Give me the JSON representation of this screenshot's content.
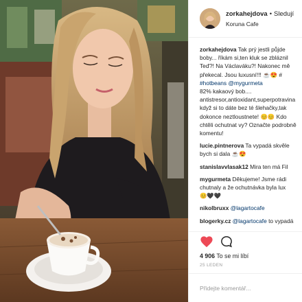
{
  "header": {
    "username": "zorkahejdova",
    "separator": "•",
    "follow_label": "Sledují",
    "location": "Koruna Cafe"
  },
  "caption": {
    "username": "zorkahejdova",
    "lines": [
      "Tak prý jestli půjde",
      "boby... říkám si,ten kluk se zbláznil",
      "Teď?! Na Václaváku?! Nakonec mě",
      "překecal. Jsou luxusní!!! "
    ],
    "hashtag": "#hotbeans",
    "mention": "@mygurmeta",
    "rest_lines": [
      "82% kakaový bob....",
      "antistresor,antioxidant,superpotravina",
      "když si to dáte bez té šlehačky,tak",
      "dokonce neztloustnete! 😊😊 Kdo",
      "chtěli ochutnat vy? Označte podrobně",
      "komentu!"
    ],
    "line4_tail": "☕😍 #",
    "line5_lead": ""
  },
  "comments": [
    {
      "username": "lucie.pintnerova",
      "lines": [
        "Ta vypadá skvěle",
        "bych si dala ☕😍"
      ]
    },
    {
      "username": "stanislavvlasak12",
      "lines": [
        "Mira ten má Fil"
      ]
    },
    {
      "username": "mygurmeta",
      "lines": [
        "Děkujeme! Jsme rádi",
        "chutnaly a že ochutnávka byla lux",
        "😊🖤🖤"
      ]
    },
    {
      "username": "nikolbruxx",
      "mention": "@lagartocafe",
      "lines": []
    },
    {
      "username": "blogerky.cz",
      "mention": "@lagartocafe",
      "lines": [
        "to vypadá"
      ]
    }
  ],
  "actions": {
    "heart_icon": "heart-filled-icon",
    "comment_icon": "comment-bubble-icon",
    "like_color": "#ed4956"
  },
  "likes": {
    "count": "4 906",
    "label": "To se mi líbí"
  },
  "date": "25 LEDEN",
  "add_comment": {
    "placeholder": "Přidejte komentář..."
  }
}
